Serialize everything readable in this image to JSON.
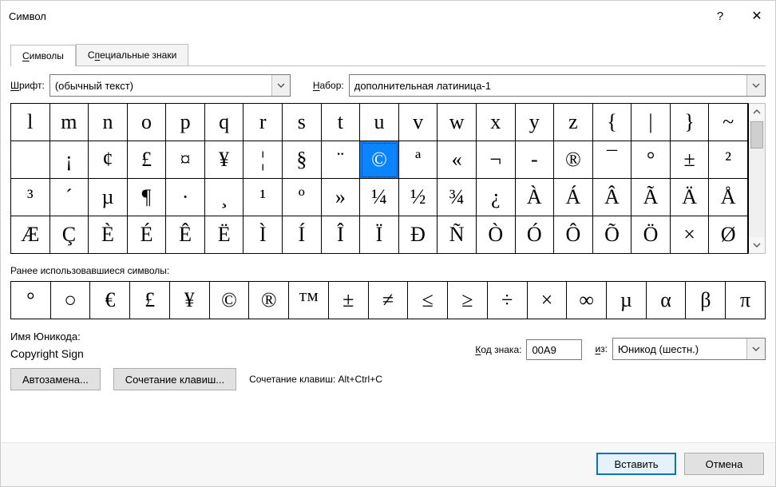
{
  "title": "Символ",
  "titlebar": {
    "help": "?",
    "close": "✕"
  },
  "tabs": [
    {
      "label_pre": "",
      "mn": "С",
      "label_post": "имволы",
      "active": true
    },
    {
      "label_pre": "С",
      "mn": "п",
      "label_post": "ециальные знаки",
      "active": false
    }
  ],
  "font_label_pre": "",
  "font_label_mn": "Ш",
  "font_label_post": "рифт:",
  "font_value": "(обычный текст)",
  "set_label_pre": "",
  "set_label_mn": "Н",
  "set_label_post": "абор:",
  "set_value": "дополнительная латиница-1",
  "grid": [
    [
      "l",
      "m",
      "n",
      "o",
      "p",
      "q",
      "r",
      "s",
      "t",
      "u",
      "v",
      "w",
      "x",
      "y",
      "z",
      "{",
      "|",
      "}",
      "~"
    ],
    [
      " ",
      "¡",
      "¢",
      "£",
      "¤",
      "¥",
      "¦",
      "§",
      "¨",
      "©",
      "ª",
      "«",
      "¬",
      "-",
      "®",
      "¯",
      "°",
      "±",
      "²"
    ],
    [
      "³",
      "´",
      "µ",
      "¶",
      "·",
      "¸",
      "¹",
      "º",
      "»",
      "¼",
      "½",
      "¾",
      "¿",
      "À",
      "Á",
      "Â",
      "Ã",
      "Ä",
      "Å"
    ],
    [
      "Æ",
      "Ç",
      "È",
      "É",
      "Ê",
      "Ë",
      "Ì",
      "Í",
      "Î",
      "Ï",
      "Ð",
      "Ñ",
      "Ò",
      "Ó",
      "Ô",
      "Õ",
      "Ö",
      "×",
      "Ø"
    ]
  ],
  "selected": {
    "row": 1,
    "col": 9
  },
  "recent_label_pre": "",
  "recent_label_mn": "Р",
  "recent_label_post": "анее использовавшиеся символы:",
  "recent": [
    "°",
    "○",
    "€",
    "£",
    "¥",
    "©",
    "®",
    "™",
    "±",
    "≠",
    "≤",
    "≥",
    "÷",
    "×",
    "∞",
    "µ",
    "α",
    "β",
    "π"
  ],
  "unicode_caption": "Имя Юникода:",
  "unicode_name": "Copyright Sign",
  "code_label_pre": "",
  "code_label_mn": "К",
  "code_label_post": "од знака:",
  "code_value": "00A9",
  "from_label_pre": "",
  "from_label_mn": "и",
  "from_label_post": "з:",
  "from_value": "Юникод (шестн.)",
  "btn_autocorrect_mn": "А",
  "btn_autocorrect_post": "втозамена...",
  "btn_shortcut": "Сочетание клавиш...",
  "shortcut_info_label": "Сочетание клавиш:",
  "shortcut_info_value": "Alt+Ctrl+C",
  "footer": {
    "insert": "Вставить",
    "cancel": "Отмена"
  }
}
